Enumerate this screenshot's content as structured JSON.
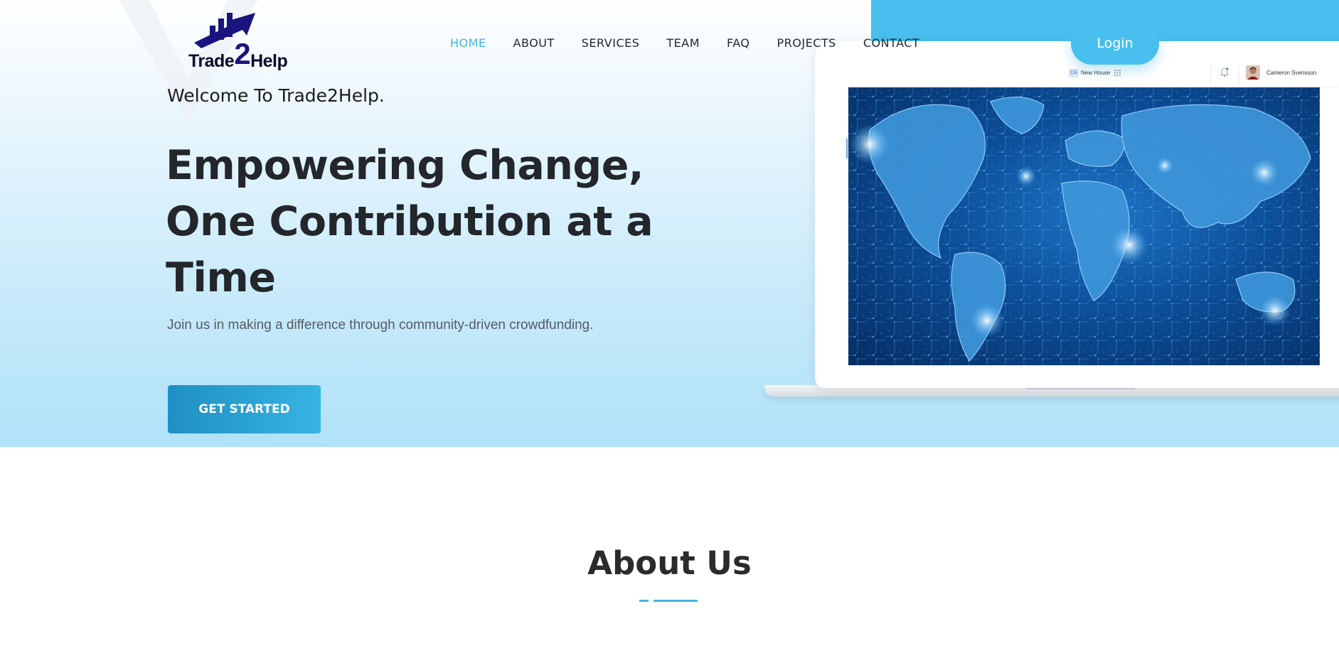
{
  "logo": {
    "part1": "Trade",
    "part2": "2",
    "part3": "Help"
  },
  "nav": {
    "items": [
      {
        "label": "HOME",
        "active": true
      },
      {
        "label": "ABOUT",
        "active": false
      },
      {
        "label": "SERVICES",
        "active": false
      },
      {
        "label": "TEAM",
        "active": false
      },
      {
        "label": "FAQ",
        "active": false
      },
      {
        "label": "PROJECTS",
        "active": false
      },
      {
        "label": "CONTACT",
        "active": false
      }
    ],
    "login_label": "Login"
  },
  "hero": {
    "welcome": "Welcome To Trade2Help.",
    "headline_line1": "Empowering Change,",
    "headline_line2": "One Contribution at a",
    "headline_line3": "Time",
    "subtitle": "Join us in making a difference through community-driven crowdfunding.",
    "cta_label": "GET STARTED"
  },
  "mockup": {
    "workspace_initials": "CA",
    "workspace_name": "New House",
    "user_name": "Cameron Svensson",
    "image_subject": "world-map-circuit"
  },
  "about": {
    "title": "About Us"
  },
  "colors": {
    "accent": "#47b2e4",
    "login_bg": "#48bfee",
    "cta_start": "#1f8fc3",
    "cta_end": "#36b4e4",
    "heading": "#23262b",
    "logo_dark": "#1a1480"
  }
}
